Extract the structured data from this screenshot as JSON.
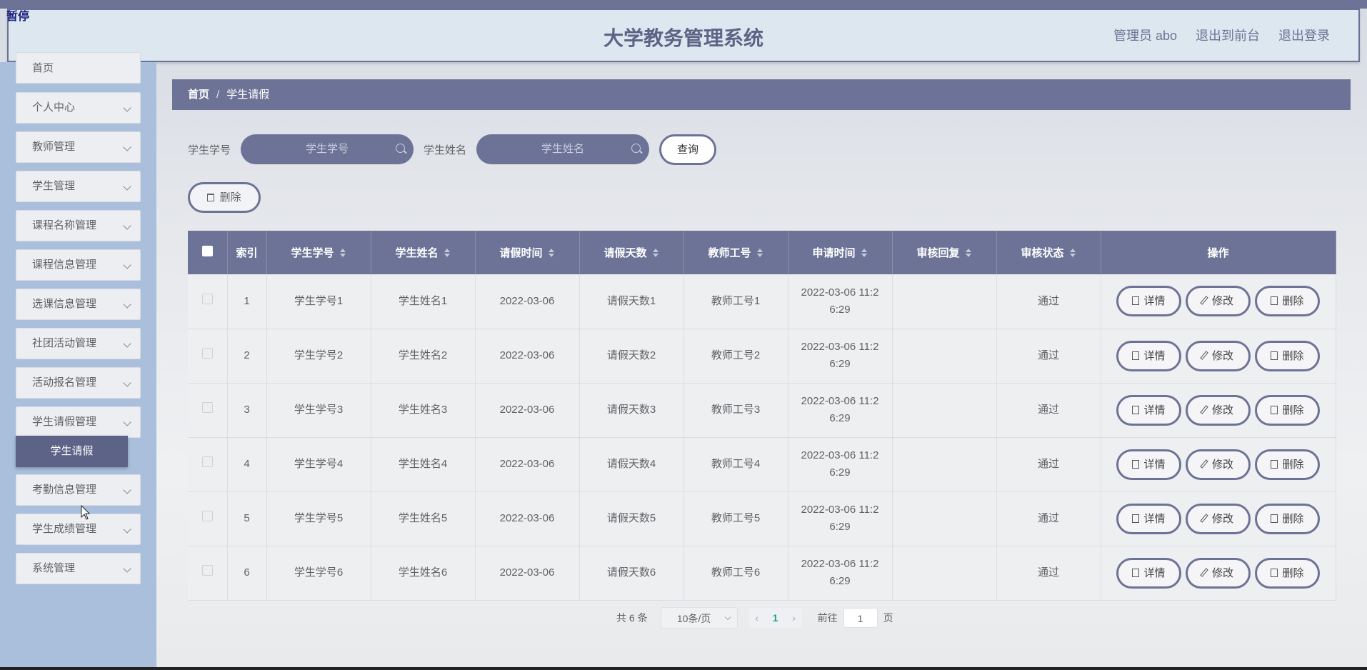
{
  "corner_tag": "暂停",
  "header": {
    "title": "大学教务管理系统",
    "user": "管理员 abo",
    "to_front": "退出到前台",
    "logout": "退出登录"
  },
  "sidebar": {
    "home": "首页",
    "items": [
      {
        "label": "个人中心"
      },
      {
        "label": "教师管理"
      },
      {
        "label": "学生管理"
      },
      {
        "label": "课程名称管理"
      },
      {
        "label": "课程信息管理"
      },
      {
        "label": "选课信息管理"
      },
      {
        "label": "社团活动管理"
      },
      {
        "label": "活动报名管理"
      },
      {
        "label": "学生请假管理"
      },
      {
        "label": "考勤信息管理"
      },
      {
        "label": "学生成绩管理"
      },
      {
        "label": "系统管理"
      }
    ],
    "active_sub": "学生请假"
  },
  "breadcrumb": {
    "home": "首页",
    "sep": "/",
    "current": "学生请假"
  },
  "search": {
    "id_label": "学生学号",
    "id_placeholder": "学生学号",
    "name_label": "学生姓名",
    "name_placeholder": "学生姓名",
    "query": "查询"
  },
  "actions": {
    "delete": "删除"
  },
  "table": {
    "headers": [
      "索引",
      "学生学号",
      "学生姓名",
      "请假时间",
      "请假天数",
      "教师工号",
      "申请时间",
      "审核回复",
      "审核状态",
      "操作"
    ],
    "rows": [
      {
        "idx": "1",
        "sid": "学生学号1",
        "name": "学生姓名1",
        "date": "2022-03-06",
        "days": "请假天数1",
        "tid": "教师工号1",
        "apply1": "2022-03-06 11:2",
        "apply2": "6:29",
        "reply": "",
        "status": "通过"
      },
      {
        "idx": "2",
        "sid": "学生学号2",
        "name": "学生姓名2",
        "date": "2022-03-06",
        "days": "请假天数2",
        "tid": "教师工号2",
        "apply1": "2022-03-06 11:2",
        "apply2": "6:29",
        "reply": "",
        "status": "通过"
      },
      {
        "idx": "3",
        "sid": "学生学号3",
        "name": "学生姓名3",
        "date": "2022-03-06",
        "days": "请假天数3",
        "tid": "教师工号3",
        "apply1": "2022-03-06 11:2",
        "apply2": "6:29",
        "reply": "",
        "status": "通过"
      },
      {
        "idx": "4",
        "sid": "学生学号4",
        "name": "学生姓名4",
        "date": "2022-03-06",
        "days": "请假天数4",
        "tid": "教师工号4",
        "apply1": "2022-03-06 11:2",
        "apply2": "6:29",
        "reply": "",
        "status": "通过"
      },
      {
        "idx": "5",
        "sid": "学生学号5",
        "name": "学生姓名5",
        "date": "2022-03-06",
        "days": "请假天数5",
        "tid": "教师工号5",
        "apply1": "2022-03-06 11:2",
        "apply2": "6:29",
        "reply": "",
        "status": "通过"
      },
      {
        "idx": "6",
        "sid": "学生学号6",
        "name": "学生姓名6",
        "date": "2022-03-06",
        "days": "请假天数6",
        "tid": "教师工号6",
        "apply1": "2022-03-06 11:2",
        "apply2": "6:29",
        "reply": "",
        "status": "通过"
      }
    ],
    "row_buttons": {
      "detail": "详情",
      "edit": "修改",
      "delete": "删除"
    }
  },
  "pagination": {
    "total": "共 6 条",
    "page_size": "10条/页",
    "current_page": "1",
    "goto_label": "前往",
    "goto_value": "1",
    "page_suffix": "页"
  }
}
